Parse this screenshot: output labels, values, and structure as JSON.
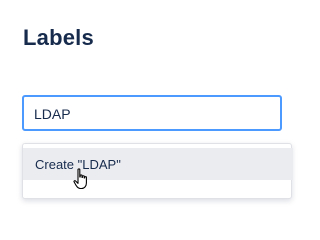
{
  "header": {
    "title": "Labels"
  },
  "label_input": {
    "value": "LDAP"
  },
  "suggestions": {
    "items": [
      {
        "label": "Create \"LDAP\""
      }
    ]
  },
  "colors": {
    "title": "#172b4d",
    "input_focus_border": "#4c9aff",
    "option_hover_bg": "#ebecf0"
  },
  "icons": {
    "pointer": "hand-pointer-cursor-icon"
  }
}
